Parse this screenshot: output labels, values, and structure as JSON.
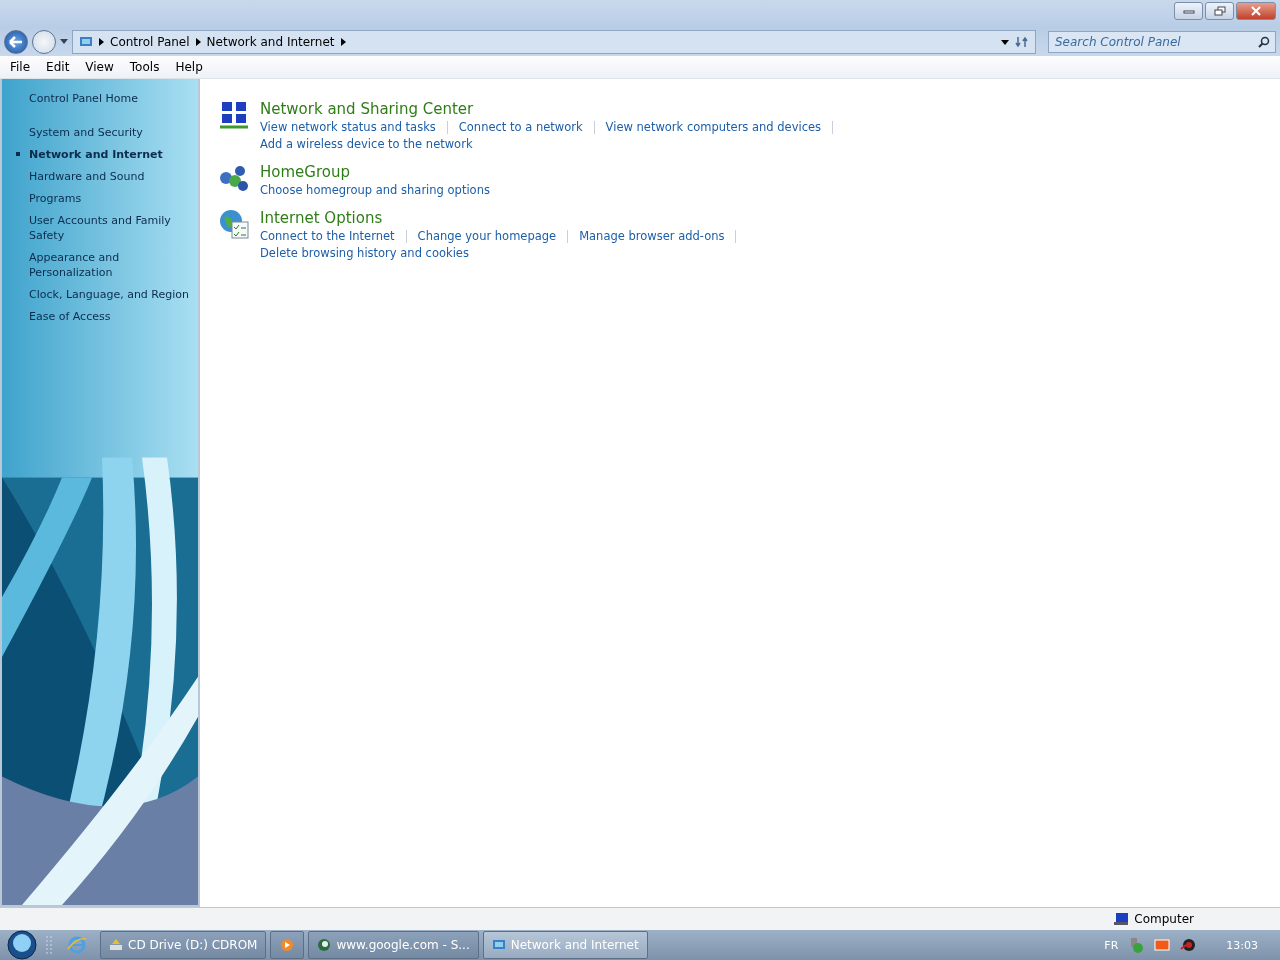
{
  "address": {
    "crumbs": [
      "Control Panel",
      "Network and Internet"
    ],
    "search_placeholder": "Search Control Panel"
  },
  "menu": [
    "File",
    "Edit",
    "View",
    "Tools",
    "Help"
  ],
  "sidebar": {
    "items": [
      {
        "label": "Control Panel Home",
        "selected": false
      },
      {
        "label": "System and Security",
        "selected": false
      },
      {
        "label": "Network and Internet",
        "selected": true
      },
      {
        "label": "Hardware and Sound",
        "selected": false
      },
      {
        "label": "Programs",
        "selected": false
      },
      {
        "label": "User Accounts and Family Safety",
        "selected": false
      },
      {
        "label": "Appearance and Personalization",
        "selected": false
      },
      {
        "label": "Clock, Language, and Region",
        "selected": false
      },
      {
        "label": "Ease of Access",
        "selected": false
      }
    ]
  },
  "categories": [
    {
      "kind": "network",
      "title": "Network and Sharing Center",
      "link_rows": [
        [
          "View network status and tasks",
          "Connect to a network",
          "View network computers and devices"
        ],
        [
          "Add a wireless device to the network"
        ]
      ]
    },
    {
      "kind": "homegroup",
      "title": "HomeGroup",
      "link_rows": [
        [
          "Choose homegroup and sharing options"
        ]
      ]
    },
    {
      "kind": "internet",
      "title": "Internet Options",
      "link_rows": [
        [
          "Connect to the Internet",
          "Change your homepage",
          "Manage browser add-ons"
        ],
        [
          "Delete browsing history and cookies"
        ]
      ]
    }
  ],
  "status_bar": {
    "location": "Computer"
  },
  "taskbar": {
    "buttons": [
      {
        "kind": "drive",
        "label": "CD Drive (D:) CDROM",
        "selected": false
      },
      {
        "kind": "media",
        "selected": false
      },
      {
        "kind": "browser",
        "label": "www.google.com - S...",
        "selected": false
      },
      {
        "kind": "folder",
        "label": "Network and Internet",
        "selected": true
      }
    ],
    "language": "FR",
    "clock": "13:03"
  }
}
